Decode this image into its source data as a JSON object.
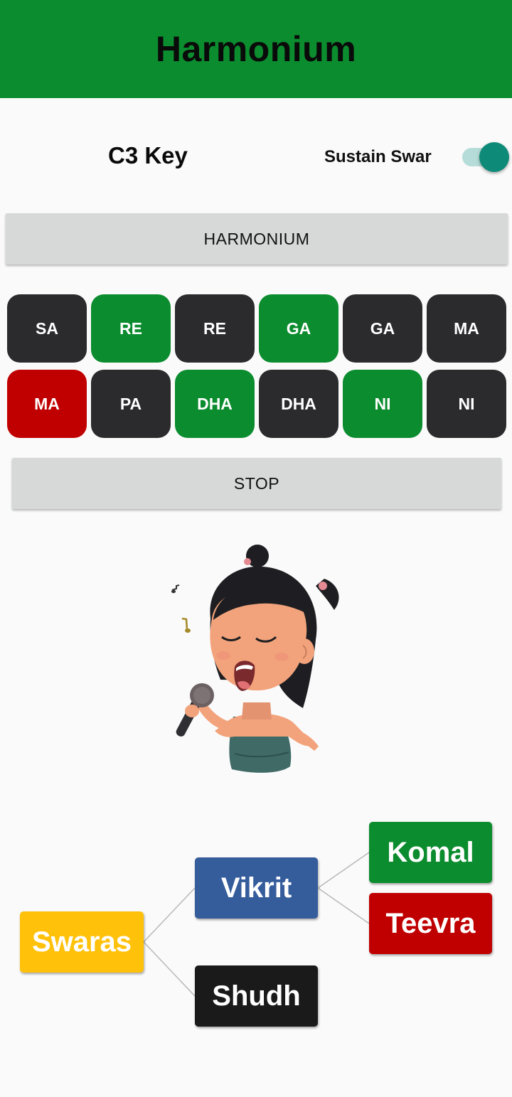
{
  "app_bar": {
    "title": "Harmonium"
  },
  "controls": {
    "key_label": "C3 Key",
    "sustain_label": "Sustain Swar",
    "sustain_on": true
  },
  "buttons": {
    "instrument": "HARMONIUM",
    "stop": "STOP"
  },
  "colors": {
    "green": "#0b8c2e",
    "black": "#2b2b2e",
    "red": "#c00000"
  },
  "keys": [
    {
      "label": "SA",
      "color": "black"
    },
    {
      "label": "RE",
      "color": "green"
    },
    {
      "label": "RE",
      "color": "black"
    },
    {
      "label": "GA",
      "color": "green"
    },
    {
      "label": "GA",
      "color": "black"
    },
    {
      "label": "MA",
      "color": "black"
    },
    {
      "label": "MA",
      "color": "red"
    },
    {
      "label": "PA",
      "color": "black"
    },
    {
      "label": "DHA",
      "color": "green"
    },
    {
      "label": "DHA",
      "color": "black"
    },
    {
      "label": "NI",
      "color": "green"
    },
    {
      "label": "NI",
      "color": "black"
    }
  ],
  "diagram": {
    "swaras": "Swaras",
    "vikrit": "Vikrit",
    "shudh": "Shudh",
    "komal": "Komal",
    "teevra": "Teevra"
  }
}
